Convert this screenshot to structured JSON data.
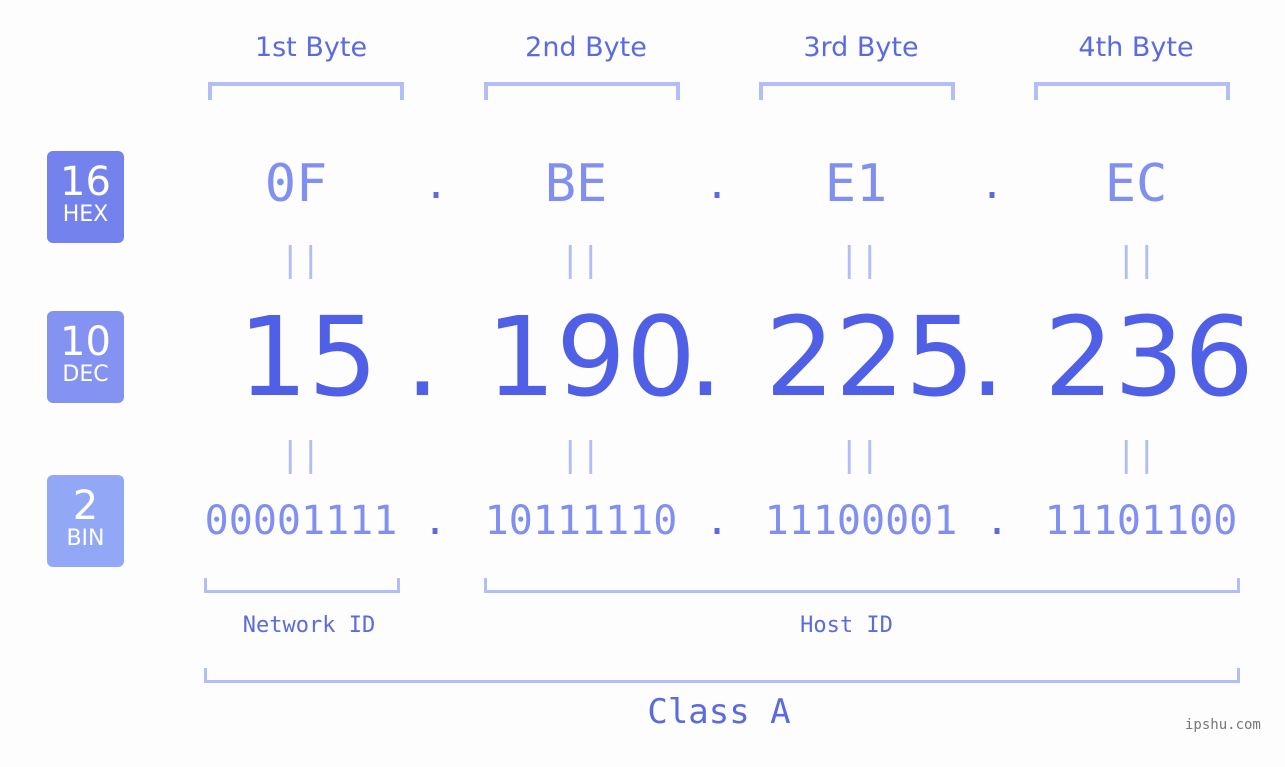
{
  "bytes": [
    {
      "label": "1st Byte",
      "hex": "0F",
      "dec": "15",
      "bin": "00001111"
    },
    {
      "label": "2nd Byte",
      "hex": "BE",
      "dec": "190",
      "bin": "10111110"
    },
    {
      "label": "3rd Byte",
      "hex": "E1",
      "dec": "225",
      "bin": "11100001"
    },
    {
      "label": "4th Byte",
      "hex": "EC",
      "dec": "236",
      "bin": "11101100"
    }
  ],
  "badges": {
    "hex": {
      "num": "16",
      "label": "HEX",
      "color": "#7382ec"
    },
    "dec": {
      "num": "10",
      "label": "DEC",
      "color": "#8493f1"
    },
    "bin": {
      "num": "2",
      "label": "BIN",
      "color": "#93a7f7"
    }
  },
  "separator": ".",
  "equals": "||",
  "network_label": "Network ID",
  "host_label": "Host ID",
  "class_label": "Class A",
  "brand": "ipshu.com"
}
